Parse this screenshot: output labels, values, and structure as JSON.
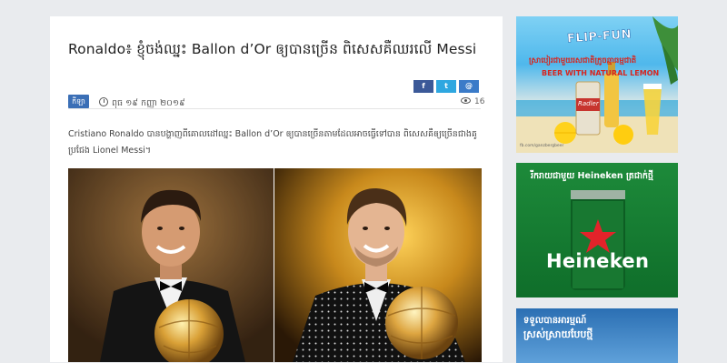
{
  "article": {
    "title": "Ronaldo៖ ខ្ញុំចង់ឈ្នះ Ballon d’Or ឲ្យបានច្រើន ពិសេសគឺឈរលើ Messi",
    "category": "កីឡា",
    "date": "ពុធ ១៩ កញ្ញា ២០១៩",
    "views": "16",
    "excerpt": "Cristiano Ronaldo បានបង្ហាញពីគោលដៅឈ្នះ Ballon d’Or ឲ្យបានច្រើនតាមដែលអាចធ្វើទៅបាន ពិសេសគឺឲ្យច្រើនជាងគូប្រជែង Lionel Messi។"
  },
  "share": {
    "facebook": "f",
    "twitter": "t",
    "email": "@"
  },
  "icons": [
    "clock-icon",
    "eye-icon",
    "facebook-icon",
    "twitter-icon",
    "email-icon"
  ],
  "ads": {
    "beer": {
      "brand": "FLIP-FUN",
      "khmer_line": "ស្រាបៀរជាមួយរសជាតិក្រូចឆ្មាធម្មជាតិ",
      "tagline": "BEER WITH NATURAL LEMON",
      "product": "Radler",
      "site": "fb.com/ganzbergbeer"
    },
    "heineken": {
      "khmer_line": "រីករាយជាមួយ Heineken ត្រជាក់ថ្មី",
      "brand": "Heineken"
    },
    "third": {
      "line1": "ទទួលបានអារម្មណ៍",
      "line2": "ស្រស់ស្រាយបែបថ្មី"
    }
  }
}
